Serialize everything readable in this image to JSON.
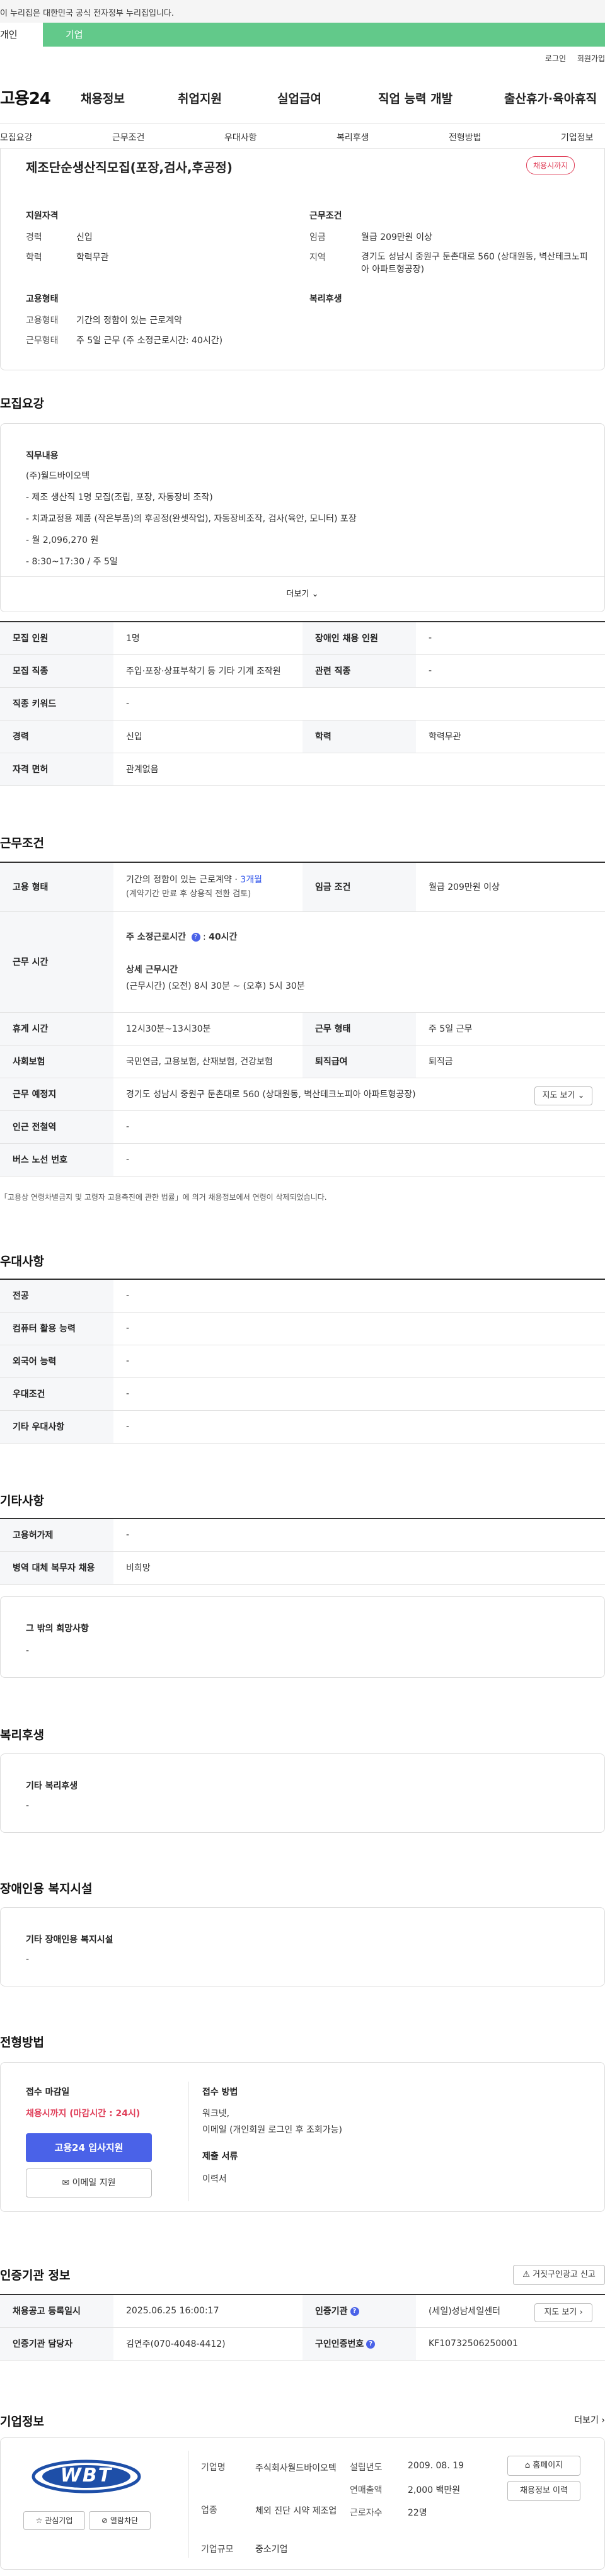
{
  "gov_notice": "이 누리집은 대한민국 공식 전자정부 누리집입니다.",
  "user_tabs": [
    "개인",
    "기업"
  ],
  "top_links": [
    "로그인",
    "회원가입"
  ],
  "logo": "고용24",
  "gnb": [
    "채용정보",
    "취업지원",
    "실업급여",
    "직업 능력 개발",
    "출산휴가·육아휴직"
  ],
  "snb": [
    "모집요강",
    "근무조건",
    "우대사항",
    "복리후생",
    "전형방법",
    "기업정보"
  ],
  "summary": {
    "title": "제조단순생산직모집(포장,검사,후공정)",
    "badge": "채용시까지",
    "qual_head": "지원자격",
    "career_label": "경력",
    "career_val": "신입",
    "edu_label": "학력",
    "edu_val": "학력무관",
    "cond_head": "근무조건",
    "wage_label": "임금",
    "wage_val": "월급 209만원 이상",
    "region_label": "지역",
    "region_val": "경기도 성남시 중원구 둔촌대로 560 (상대원동, 벽산테크노피아 아파트형공장)",
    "emp_head": "고용형태",
    "type_label": "고용형태",
    "type_val": "기간의 정함이 있는 근로계약",
    "work_label": "근무형태",
    "work_val": "주 5일 근무 (주 소정근로시간: 40시간)",
    "welfare_head": "복리후생"
  },
  "recruit": {
    "title": "모집요강",
    "duty_head": "직무내용",
    "lines": [
      "(주)월드바이오텍",
      "- 제조 생산직 1명 모집(조립, 포장, 자동장비 조작)",
      "- 치과교정용 제품 (작은부품)의 후공정(완셋작업), 자동장비조작, 검사(육안, 모니터) 포장",
      "- 월 2,096,270 원",
      "- 8:30~17:30 / 주 5일"
    ],
    "more": "더보기",
    "table": {
      "r1": [
        "모집 인원",
        "1명",
        "장애인 채용 인원",
        "-"
      ],
      "r2": [
        "모집 직종",
        "주입·포장·상표부착기 등 기타 기계 조작원",
        "관련 직종",
        "-"
      ],
      "r3": [
        "직종 키워드",
        "-"
      ],
      "r4": [
        "경력",
        "신입",
        "학력",
        "학력무관"
      ],
      "r5": [
        "자격 면허",
        "관계없음"
      ]
    }
  },
  "work": {
    "title": "근무조건",
    "emp_label": "고용 형태",
    "emp_val": "기간의 정함이 있는 근로계약",
    "emp_months": "3개월",
    "emp_sub": "(계약기간 만료 후 상용직 전환 검토)",
    "wage_label": "임금 조건",
    "wage_val": "월급 209만원 이상",
    "hours_label": "근무 시간",
    "hours_head": "주 소정근로시간",
    "hours_head_val": "40시간",
    "hours_detail_head": "상세 근무시간",
    "hours_detail": "(근무시간) (오전) 8시 30분 ~ (오후) 5시 30분",
    "break_label": "휴게 시간",
    "break_val": "12시30분~13시30분",
    "form_label": "근무 형태",
    "form_val": "주 5일 근무",
    "ins_label": "사회보험",
    "ins_val": "국민연금, 고용보험, 산재보험, 건강보험",
    "ret_label": "퇴직급여",
    "ret_val": "퇴직금",
    "place_label": "근무 예정지",
    "place_val": "경기도 성남시 중원구 둔촌대로 560 (상대원동, 벽산테크노피아 아파트형공장)",
    "map_btn": "지도 보기",
    "subway_label": "인근 전철역",
    "subway_val": "-",
    "bus_label": "버스 노선 번호",
    "bus_val": "-",
    "note": "「고용상 연령차별금지 및 고령자 고용촉진에 관한 법률」에 의거 채용정보에서 연령이 삭제되었습니다."
  },
  "pref": {
    "title": "우대사항",
    "rows": [
      [
        "전공",
        "-"
      ],
      [
        "컴퓨터 활용 능력",
        "-"
      ],
      [
        "외국어 능력",
        "-"
      ],
      [
        "우대조건",
        "-"
      ],
      [
        "기타 우대사항",
        "-"
      ]
    ]
  },
  "etc": {
    "title": "기타사항",
    "rows": [
      [
        "고용허가제",
        "-"
      ],
      [
        "병역 대체 복무자 채용",
        "비희망"
      ]
    ],
    "hope_head": "그 밖의 희망사항",
    "hope_val": "-"
  },
  "welfare": {
    "title": "복리후생",
    "head": "기타 복리후생",
    "val": "-"
  },
  "disab": {
    "title": "장애인용 복지시설",
    "head": "기타 장애인용 복지시설",
    "val": "-"
  },
  "screen": {
    "title": "전형방법",
    "deadline_head": "접수 마감일",
    "deadline_val": "채용시까지 (마감시간 : 24시)",
    "apply_btn": "고용24 입사지원",
    "email_btn": "이메일 지원",
    "method_head": "접수 방법",
    "method_lines": [
      "워크넷,",
      "이메일 (개인회원 로그인 후 조회가능)"
    ],
    "doc_head": "제출 서류",
    "doc_val": "이력서"
  },
  "cert": {
    "title": "인증기관 정보",
    "report_btn": "거짓구인광고 신고",
    "reg_label": "채용공고 등록일시",
    "reg_val": "2025.06.25 16:00:17",
    "agency_label": "인증기관",
    "agency_val": "(세일)성남세일센터",
    "map_btn": "지도 보기",
    "mgr_label": "인증기관 담당자",
    "mgr_val": "김연주(070-4048-4412)",
    "num_label": "구인인증번호",
    "num_val": "KF10732506250001"
  },
  "company": {
    "title": "기업정보",
    "more": "더보기",
    "logo_text": "WBT",
    "interest_btn": "관심기업",
    "block_btn": "열람차단",
    "name_label": "기업명",
    "name_val": "주식회사월드바이오텍",
    "ind_label": "업종",
    "ind_val": "체외 진단 시약 제조업",
    "scale_label": "기업규모",
    "scale_val": "중소기업",
    "est_label": "설립년도",
    "est_val": "2009. 08. 19",
    "sales_label": "연매출액",
    "sales_val": "2,000 백만원",
    "emp_label": "근로자수",
    "emp_val": "22명",
    "home_btn": "홈페이지",
    "list_btn": "채용정보 이력"
  }
}
